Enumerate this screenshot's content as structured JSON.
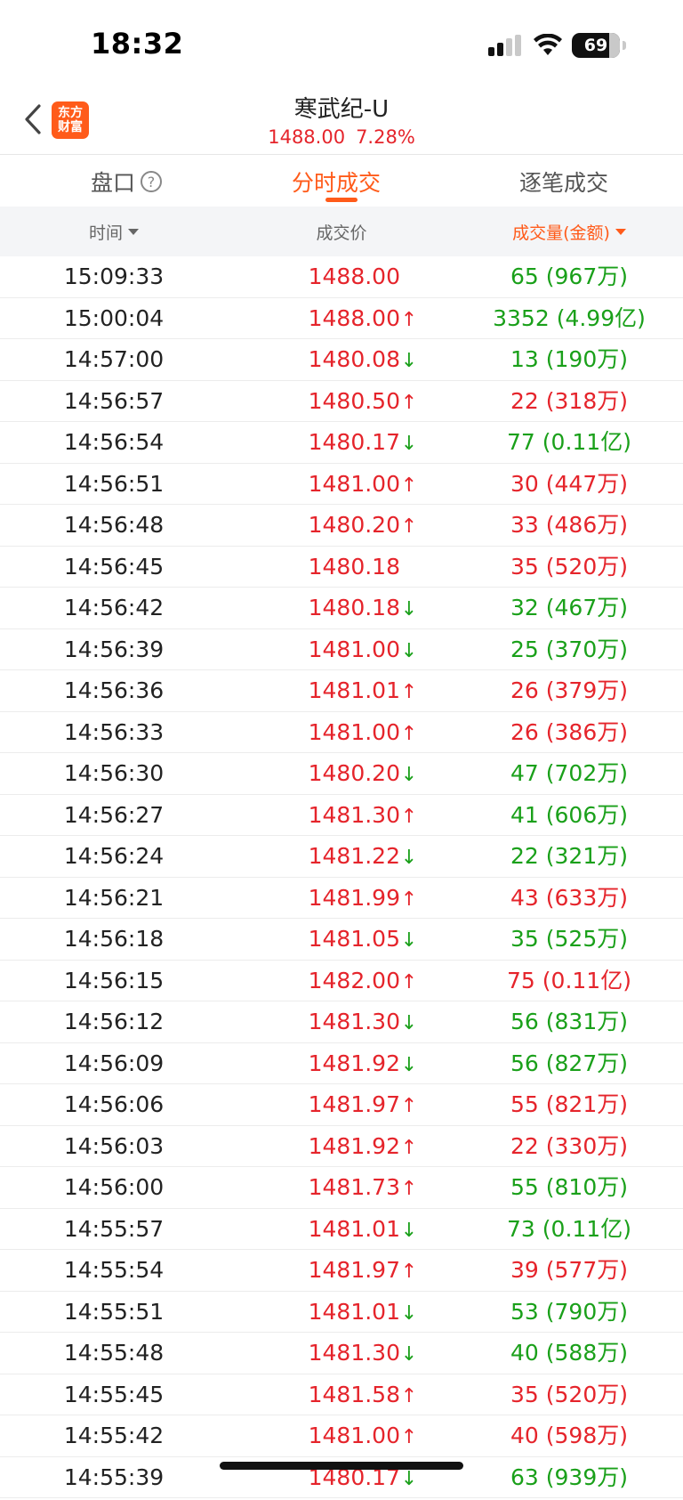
{
  "status_bar": {
    "time": "18:32",
    "battery": "69"
  },
  "header": {
    "logo_line1": "东方",
    "logo_line2": "财富",
    "title": "寒武纪-U",
    "price": "1488.00",
    "change_pct": "7.28%"
  },
  "tabs": [
    {
      "label": "盘口",
      "active": false
    },
    {
      "label": "分时成交",
      "active": true
    },
    {
      "label": "逐笔成交",
      "active": false
    }
  ],
  "columns": {
    "time": "时间",
    "price": "成交价",
    "volume": "成交量(金额)"
  },
  "colors": {
    "accent": "#ff5b1a",
    "up_red": "#e5242b",
    "down_green": "#1aa01a"
  },
  "trades": [
    {
      "time": "15:09:33",
      "price": "1488.00",
      "arrow": "",
      "volume": "65 (967万)",
      "side": "sell"
    },
    {
      "time": "15:00:04",
      "price": "1488.00",
      "arrow": "up",
      "volume": "3352 (4.99亿)",
      "side": "sell"
    },
    {
      "time": "14:57:00",
      "price": "1480.08",
      "arrow": "down",
      "volume": "13 (190万)",
      "side": "sell"
    },
    {
      "time": "14:56:57",
      "price": "1480.50",
      "arrow": "up",
      "volume": "22 (318万)",
      "side": "buy"
    },
    {
      "time": "14:56:54",
      "price": "1480.17",
      "arrow": "down",
      "volume": "77 (0.11亿)",
      "side": "sell"
    },
    {
      "time": "14:56:51",
      "price": "1481.00",
      "arrow": "up",
      "volume": "30 (447万)",
      "side": "buy"
    },
    {
      "time": "14:56:48",
      "price": "1480.20",
      "arrow": "up",
      "volume": "33 (486万)",
      "side": "buy"
    },
    {
      "time": "14:56:45",
      "price": "1480.18",
      "arrow": "",
      "volume": "35 (520万)",
      "side": "buy"
    },
    {
      "time": "14:56:42",
      "price": "1480.18",
      "arrow": "down",
      "volume": "32 (467万)",
      "side": "sell"
    },
    {
      "time": "14:56:39",
      "price": "1481.00",
      "arrow": "down",
      "volume": "25 (370万)",
      "side": "sell"
    },
    {
      "time": "14:56:36",
      "price": "1481.01",
      "arrow": "up",
      "volume": "26 (379万)",
      "side": "buy"
    },
    {
      "time": "14:56:33",
      "price": "1481.00",
      "arrow": "up",
      "volume": "26 (386万)",
      "side": "buy"
    },
    {
      "time": "14:56:30",
      "price": "1480.20",
      "arrow": "down",
      "volume": "47 (702万)",
      "side": "sell"
    },
    {
      "time": "14:56:27",
      "price": "1481.30",
      "arrow": "up",
      "volume": "41 (606万)",
      "side": "sell"
    },
    {
      "time": "14:56:24",
      "price": "1481.22",
      "arrow": "down",
      "volume": "22 (321万)",
      "side": "sell"
    },
    {
      "time": "14:56:21",
      "price": "1481.99",
      "arrow": "up",
      "volume": "43 (633万)",
      "side": "buy"
    },
    {
      "time": "14:56:18",
      "price": "1481.05",
      "arrow": "down",
      "volume": "35 (525万)",
      "side": "sell"
    },
    {
      "time": "14:56:15",
      "price": "1482.00",
      "arrow": "up",
      "volume": "75 (0.11亿)",
      "side": "buy"
    },
    {
      "time": "14:56:12",
      "price": "1481.30",
      "arrow": "down",
      "volume": "56 (831万)",
      "side": "sell"
    },
    {
      "time": "14:56:09",
      "price": "1481.92",
      "arrow": "down",
      "volume": "56 (827万)",
      "side": "sell"
    },
    {
      "time": "14:56:06",
      "price": "1481.97",
      "arrow": "up",
      "volume": "55 (821万)",
      "side": "buy"
    },
    {
      "time": "14:56:03",
      "price": "1481.92",
      "arrow": "up",
      "volume": "22 (330万)",
      "side": "buy"
    },
    {
      "time": "14:56:00",
      "price": "1481.73",
      "arrow": "up",
      "volume": "55 (810万)",
      "side": "sell"
    },
    {
      "time": "14:55:57",
      "price": "1481.01",
      "arrow": "down",
      "volume": "73 (0.11亿)",
      "side": "sell"
    },
    {
      "time": "14:55:54",
      "price": "1481.97",
      "arrow": "up",
      "volume": "39 (577万)",
      "side": "buy"
    },
    {
      "time": "14:55:51",
      "price": "1481.01",
      "arrow": "down",
      "volume": "53 (790万)",
      "side": "sell"
    },
    {
      "time": "14:55:48",
      "price": "1481.30",
      "arrow": "down",
      "volume": "40 (588万)",
      "side": "sell"
    },
    {
      "time": "14:55:45",
      "price": "1481.58",
      "arrow": "up",
      "volume": "35 (520万)",
      "side": "buy"
    },
    {
      "time": "14:55:42",
      "price": "1481.00",
      "arrow": "up",
      "volume": "40 (598万)",
      "side": "buy"
    },
    {
      "time": "14:55:39",
      "price": "1480.17",
      "arrow": "down",
      "volume": "63 (939万)",
      "side": "sell"
    }
  ]
}
